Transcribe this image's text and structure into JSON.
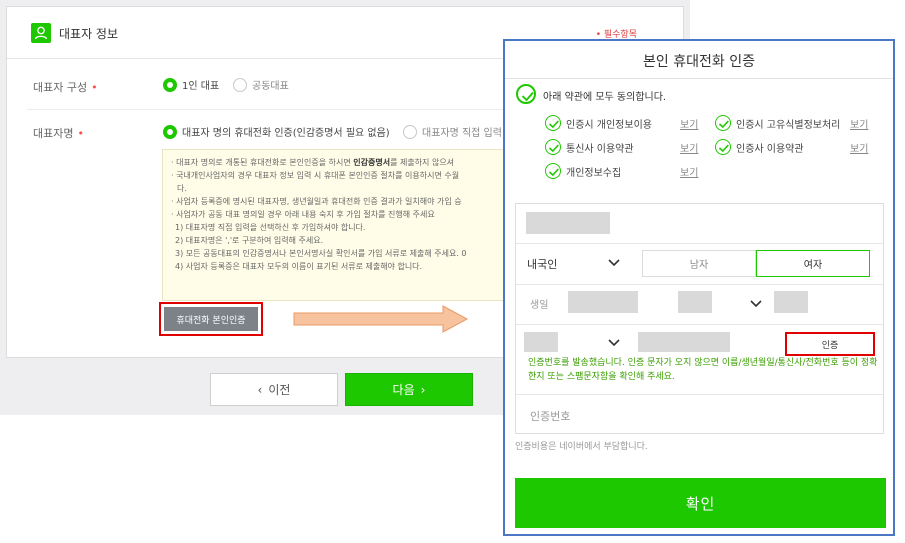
{
  "form": {
    "section_title": "대표자 정보",
    "required_note": "• 필수항목",
    "composition": {
      "label": "대표자 구성",
      "options": [
        "1인 대표",
        "공동대표"
      ]
    },
    "rep_name": {
      "label": "대표자명",
      "options": [
        "대표자 명의 휴대전화 인증(인감증명서 필요 없음)",
        "대표자명 직접 입력"
      ]
    },
    "guide_lines": [
      "· 대표자 명의로 개통된 휴대전화로 본인인증을 하시면 ",
      "· 국내개인사업자의 경우 대표자 정보 입력 시 휴대폰 본인인증 절차를 이용하시면 수월",
      "다.",
      "· 사업자 등록증에 명시된 대표자명, 생년월일과 휴대전화 인증 결과가 일치해야 가입 승",
      "· 사업자가 공동 대표 명의일 경우 아래 내용 숙지 후 가입 절차를 진행해 주세요",
      "1) 대표자명 직접 입력을 선택하신 후 가입하셔야 합니다.",
      "2) 대표자명은 ','로 구분하여 입력해 주세요.",
      "3) 모든 공동대표의 인감증명서나 본인서명사실 확인서를 가입 서류로 제출해 주세요. 0",
      "4) 사업자 등록증은 대표자 모두의 이름이 표기된 서류로 제출해야 합니다."
    ],
    "guide_bold": "인감증명서",
    "guide_bold_tail": "를 제출하지 않으셔",
    "verify_button": "휴대전화 본인인증",
    "prev_button": "이전",
    "next_button": "다음"
  },
  "modal": {
    "title": "본인 휴대전화 인증",
    "agree_all": "아래 약관에 모두 동의합니다.",
    "terms": [
      {
        "label": "인증시 개인정보이용",
        "link": "보기"
      },
      {
        "label": "인증시 고유식별정보처리",
        "link": "보기"
      },
      {
        "label": "통신사 이용약관",
        "link": "보기"
      },
      {
        "label": "인증사 이용약관",
        "link": "보기"
      },
      {
        "label": "개인정보수집",
        "link": "보기"
      }
    ],
    "nationality": "내국인",
    "gender_male": "남자",
    "gender_female": "여자",
    "birth_label": "생일",
    "auth_button": "인증",
    "sent_message": "인증번호를 발송했습니다. 인증 문자가 오지 않으면 이름/생년월일/통신사/전화번호 등이 정확한지 또는 스팸문자함을 확인해 주세요.",
    "code_placeholder": "인증번호",
    "fee_note": "인증비용은 네이버에서 부담합니다.",
    "confirm_button": "확인"
  },
  "colors": {
    "accent_green": "#1ec800",
    "highlight_red": "#e00000",
    "modal_border": "#4a78c4"
  }
}
